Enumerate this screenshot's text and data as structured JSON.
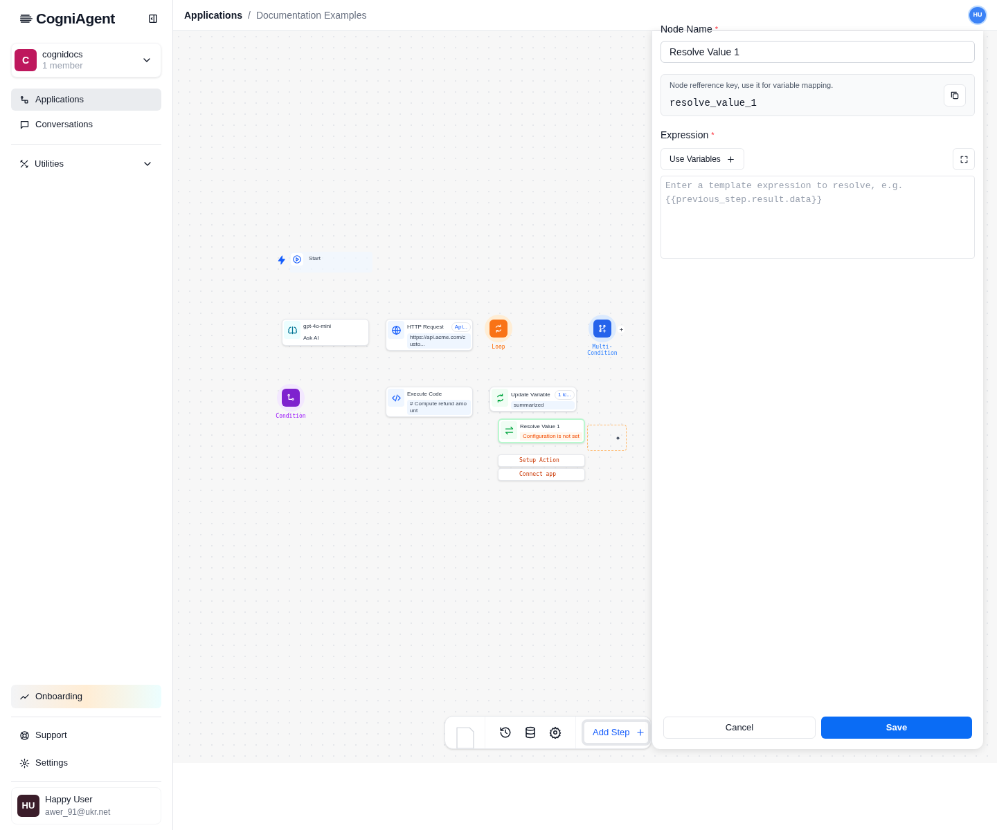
{
  "sidebar": {
    "logo": "CogniAgent",
    "workspace": {
      "initial": "C",
      "name": "cognidocs",
      "members": "1 member"
    },
    "nav": [
      {
        "label": "Applications",
        "selected": true
      },
      {
        "label": "Conversations",
        "selected": false
      }
    ],
    "utilities": {
      "label": "Utilities",
      "expanded": false
    },
    "onboarding": "Onboarding",
    "bottom_nav": [
      "Support",
      "Settings"
    ],
    "user": {
      "initials": "HU",
      "name": "Happy User",
      "email": "awer_91@ukr.net"
    }
  },
  "breadcrumb": [
    "Applications",
    "Documentation Examples"
  ],
  "breadcrumb_separator": "/",
  "avatar": "HU",
  "canvas": {
    "nodes": [
      {
        "kind": "trigger",
        "title": "Start"
      },
      {
        "kind": "card",
        "title": "gpt-4o-mini",
        "subtitle": "Ask AI"
      },
      {
        "kind": "card",
        "title": "HTTP Request",
        "badge": "Api...",
        "subtitle": "https://api.acme.com/custo..."
      },
      {
        "kind": "round",
        "label": "Loop"
      },
      {
        "kind": "round",
        "label": "Multi-Condition"
      },
      {
        "kind": "round",
        "label": "Condition"
      },
      {
        "kind": "card",
        "title": "Execute Code",
        "subtitle": "# Compute refund amount"
      },
      {
        "kind": "card",
        "title": "Update Variable",
        "badge": "1 ic...",
        "subtitle": "summarized"
      },
      {
        "kind": "error",
        "title": "Resolve Value 1",
        "subtitle": "Configuration is not set"
      },
      {
        "kind": "stub",
        "subtitle": "Setup Action"
      },
      {
        "kind": "stub",
        "subtitle": "Connect app"
      }
    ]
  },
  "toolbar": {
    "add_step": "Add Step"
  },
  "panel": {
    "required_mark": "*",
    "name_label": "Node Name",
    "name_value": "Resolve Value 1",
    "ref_hint": "Node refference key, use it for variable mapping.",
    "ref_key": "resolve_value_1",
    "expr_label": "Expression",
    "use_variables": "Use Variables",
    "expr_placeholder": "Enter a template expression to resolve, e.g. {{previous_step.result.data}}",
    "cancel": "Cancel",
    "save": "Save"
  }
}
